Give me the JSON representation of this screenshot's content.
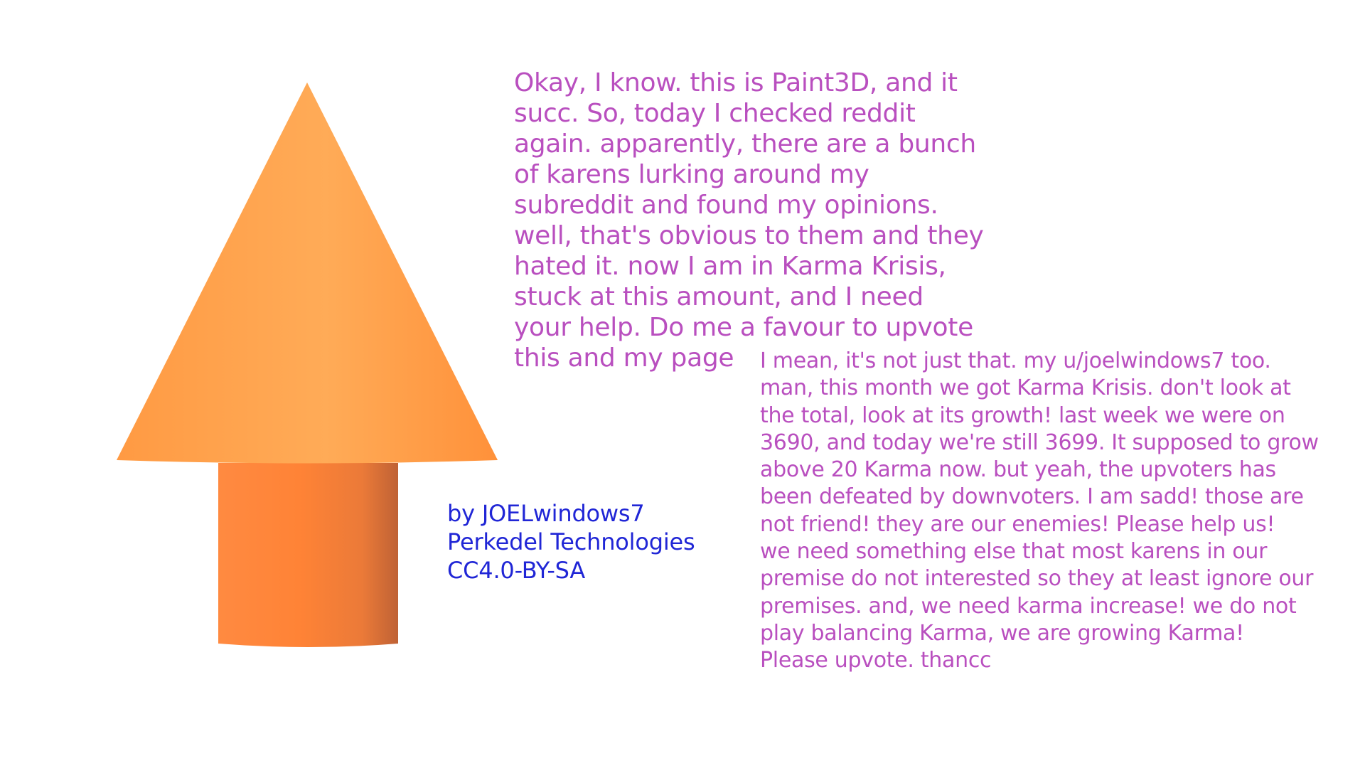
{
  "colors": {
    "background": "#ffffff",
    "arrow_head_light": "#ffa64d",
    "arrow_head_dark": "#ff8f38",
    "arrow_shaft_light": "#ff8a3d",
    "arrow_shaft_dark": "#cf6a33",
    "message_text": "#b94fbf",
    "credits_text": "#2026d6"
  },
  "icon": "upvote-arrow-icon",
  "messages": {
    "main": "Okay, I know. this is Paint3D, and it\nsucc. So, today I checked reddit\nagain. apparently, there are a bunch\nof karens lurking around my\nsubreddit and found my opinions.\nwell, that's obvious to them and they\nhated it. now I am in Karma Krisis,\nstuck at this amount, and I need\nyour help. Do me a favour to upvote\nthis and my page",
    "followup": "I mean, it's not just that. my u/joelwindows7 too.\nman, this month we got Karma Krisis. don't look at\nthe total, look at its growth! last week we were on\n3690, and today we're still 3699. It supposed to grow\nabove 20 Karma now. but yeah, the upvoters has\nbeen defeated by downvoters. I am sadd! those are\nnot friend! they are our enemies! Please help us!\nwe need something else that most karens in our\npremise do not interested so they at least ignore our\npremises. and, we need karma increase! we do not\nplay balancing Karma, we are growing Karma!\nPlease upvote. thancc"
  },
  "credits": {
    "text": "by JOELwindows7\nPerkedel Technologies\nCC4.0-BY-SA"
  }
}
